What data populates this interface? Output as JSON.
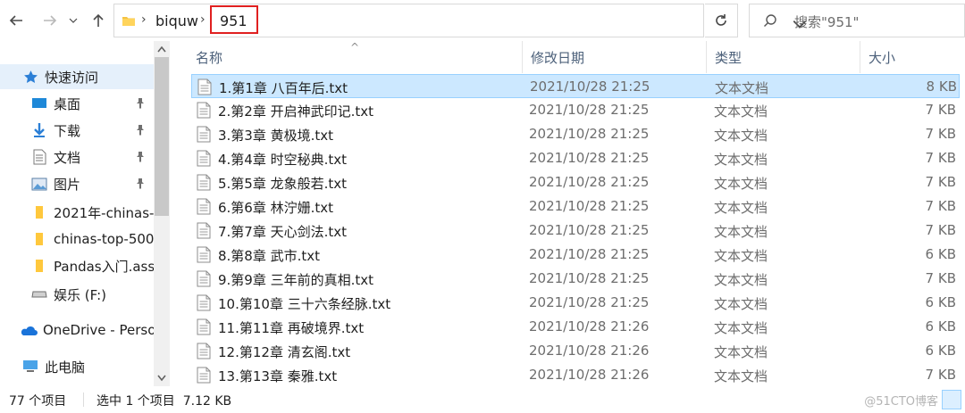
{
  "address": {
    "breadcrumbs": [
      "biquw",
      "951"
    ],
    "search_placeholder": "搜索\"951\""
  },
  "sidebar": {
    "items": [
      {
        "label": "快速访问",
        "icon": "star-icon"
      },
      {
        "label": "桌面",
        "icon": "desktop-icon",
        "pinned": true
      },
      {
        "label": "下载",
        "icon": "download-icon",
        "pinned": true
      },
      {
        "label": "文档",
        "icon": "document-icon",
        "pinned": true
      },
      {
        "label": "图片",
        "icon": "pictures-icon",
        "pinned": true
      },
      {
        "label": "2021年-chinas-",
        "icon": "folder-icon"
      },
      {
        "label": "chinas-top-500",
        "icon": "folder-icon"
      },
      {
        "label": "Pandas入门.ass",
        "icon": "folder-icon"
      },
      {
        "label": "娱乐 (F:)",
        "icon": "drive-icon"
      },
      {
        "label": "OneDrive - Perso",
        "icon": "onedrive-icon"
      },
      {
        "label": "此电脑",
        "icon": "this-pc-icon"
      }
    ]
  },
  "columns": {
    "name": "名称",
    "date": "修改日期",
    "type": "类型",
    "size": "大小"
  },
  "files": [
    {
      "name": "1.第1章 八百年后.txt",
      "date": "2021/10/28 21:25",
      "type": "文本文档",
      "size": "8 KB",
      "selected": true
    },
    {
      "name": "2.第2章 开启神武印记.txt",
      "date": "2021/10/28 21:25",
      "type": "文本文档",
      "size": "7 KB"
    },
    {
      "name": "3.第3章 黄极境.txt",
      "date": "2021/10/28 21:25",
      "type": "文本文档",
      "size": "7 KB"
    },
    {
      "name": "4.第4章 时空秘典.txt",
      "date": "2021/10/28 21:25",
      "type": "文本文档",
      "size": "7 KB"
    },
    {
      "name": "5.第5章 龙象般若.txt",
      "date": "2021/10/28 21:25",
      "type": "文本文档",
      "size": "7 KB"
    },
    {
      "name": "6.第6章 林泞姗.txt",
      "date": "2021/10/28 21:25",
      "type": "文本文档",
      "size": "7 KB"
    },
    {
      "name": "7.第7章 天心剑法.txt",
      "date": "2021/10/28 21:25",
      "type": "文本文档",
      "size": "7 KB"
    },
    {
      "name": "8.第8章 武市.txt",
      "date": "2021/10/28 21:25",
      "type": "文本文档",
      "size": "6 KB"
    },
    {
      "name": "9.第9章 三年前的真相.txt",
      "date": "2021/10/28 21:25",
      "type": "文本文档",
      "size": "7 KB"
    },
    {
      "name": "10.第10章 三十六条经脉.txt",
      "date": "2021/10/28 21:25",
      "type": "文本文档",
      "size": "6 KB"
    },
    {
      "name": "11.第11章 再破境界.txt",
      "date": "2021/10/28 21:26",
      "type": "文本文档",
      "size": "6 KB"
    },
    {
      "name": "12.第12章 清玄阁.txt",
      "date": "2021/10/28 21:26",
      "type": "文本文档",
      "size": "6 KB"
    },
    {
      "name": "13.第13章 秦雅.txt",
      "date": "2021/10/28 21:26",
      "type": "文本文档",
      "size": "7 KB"
    }
  ],
  "status": {
    "item_count": "77 个项目",
    "selection": "选中 1 个项目  7.12 KB",
    "watermark": "@51CTO博客"
  }
}
